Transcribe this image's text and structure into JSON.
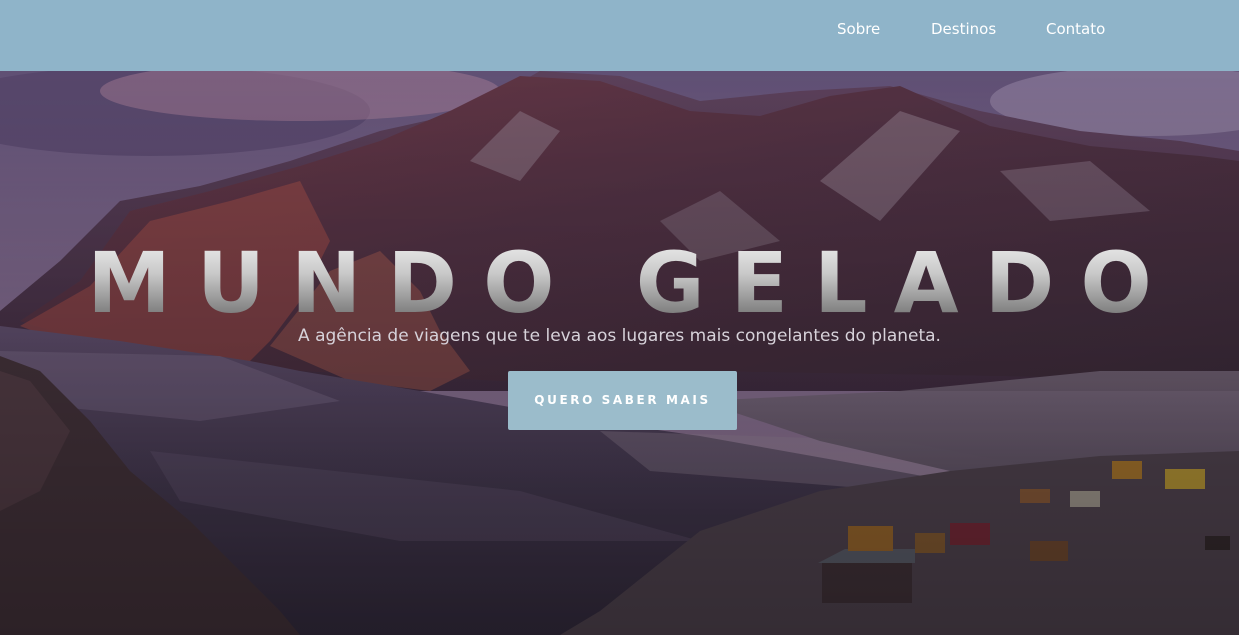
{
  "nav": {
    "items": [
      {
        "label": "Sobre"
      },
      {
        "label": "Destinos"
      },
      {
        "label": "Contato"
      }
    ],
    "background_color": "#8fb4c9"
  },
  "hero": {
    "title": "MUNDO GELADO",
    "subtitle": "A agência de viagens que te leva aos lugares mais congelantes do planeta.",
    "cta_label": "QUERO SABER MAIS",
    "cta_color": "#9bbccb"
  }
}
